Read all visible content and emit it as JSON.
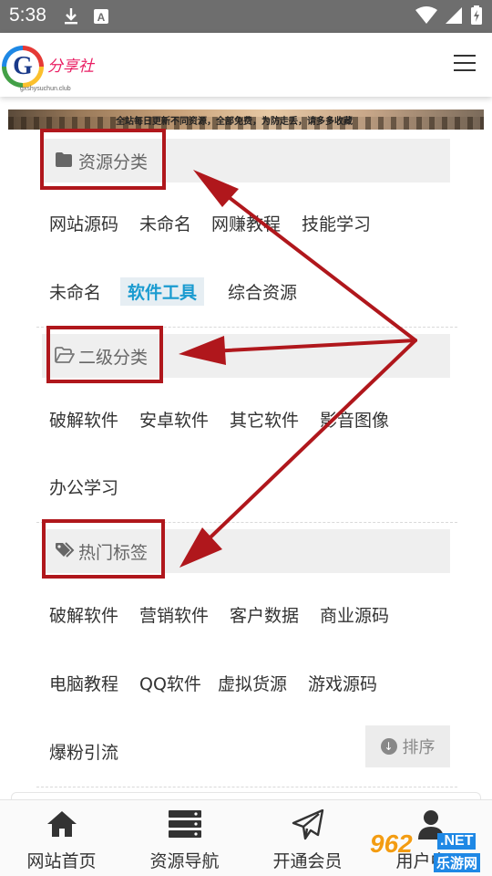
{
  "status_bar": {
    "time": "5:38"
  },
  "header": {
    "logo_brand": "分享社",
    "logo_letter": "G",
    "logo_url": "gxshysuchun.club"
  },
  "banner": {
    "text": "全站每日更新不同资源，全部免费，为防走丢，请多多收藏"
  },
  "sections": {
    "category": {
      "title": "资源分类",
      "items": [
        "网站源码",
        "未命名",
        "网赚教程",
        "技能学习",
        "未命名",
        "软件工具",
        "综合资源"
      ],
      "active": "软件工具"
    },
    "subcategory": {
      "title": "二级分类",
      "items": [
        "破解软件",
        "安卓软件",
        "其它软件",
        "影音图像",
        "办公学习"
      ]
    },
    "hot_tags": {
      "title": "热门标签",
      "items": [
        "破解软件",
        "营销软件",
        "客户数据",
        "商业源码",
        "电脑教程",
        "QQ软件",
        "虚拟货源",
        "游戏源码",
        "爆粉引流"
      ]
    }
  },
  "sort_button": {
    "label": "排序"
  },
  "bottom_nav": [
    {
      "label": "网站首页",
      "icon": "home-icon"
    },
    {
      "label": "资源导航",
      "icon": "server-icon"
    },
    {
      "label": "开通会员",
      "icon": "paper-plane-icon"
    },
    {
      "label": "用户中心",
      "icon": "user-icon"
    }
  ],
  "watermark": {
    "num": "962",
    "net": ".NET",
    "site": "乐游网"
  },
  "colors": {
    "accent": "#1a9bd0",
    "annotation": "#b0171c",
    "status_bar": "#6e6e6e"
  }
}
